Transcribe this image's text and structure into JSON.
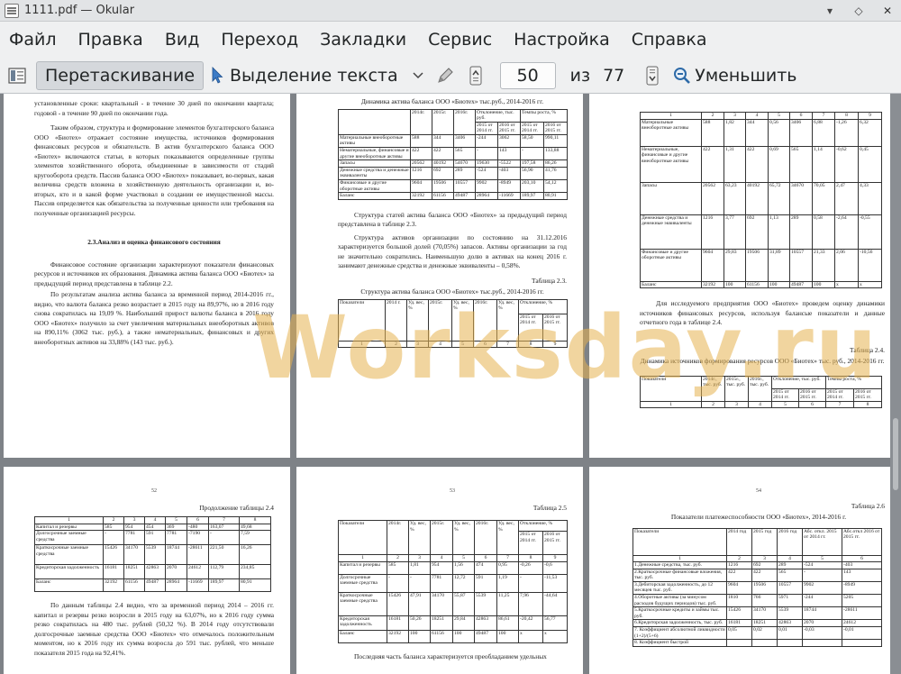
{
  "window": {
    "title": "1111.pdf  — Okular"
  },
  "menu": [
    "Файл",
    "Правка",
    "Вид",
    "Переход",
    "Закладки",
    "Сервис",
    "Настройка",
    "Справка"
  ],
  "toolbar": {
    "drag_label": "Перетаскивание",
    "select_label": "Выделение текста",
    "page_value": "50",
    "of_label": "из",
    "total_pages": "77",
    "zoom_out_label": "Уменьшить"
  },
  "watermark": "Worksday.ru",
  "page1": {
    "p1": "установленные сроки: квартальный - в течение 30 дней по окончании квартала; годовой - в течение 90 дней по окончании года.",
    "p2": "Таким образом, структура и формирование элементов бухгалтерского баланса ООО «Биотех» отражает состояние имущества, источников формирования финансовых ресурсов и обязательств. В актив бухгалтерского баланса ООО «Биотех» включаются статьи, в которых показываются определенные группы элементов хозяйственного оборота, объединенные в зависимости от стадий кругооборота средств. Пассив баланса ООО «Биотех» показывает, во-первых, какая величина средств вложена в хозяйственную деятельность организации и, во-вторых, кто и в какой форме участвовал в создании ее имущественной массы. Пассив определяется как обязательства за полученные ценности или требования на полученные организацией ресурсы.",
    "heading": "2.3.Анализ и оценка финансового состояния",
    "p3": "Финансовое состояние организации характеризуют показатели финансовых ресурсов и источников их образования. Динамика актива баланса ООО «Биотех» за предыдущий период представлена в таблице 2.2.",
    "p4": "По результатам анализа актива баланса за временной период 2014-2016 гг., видно, что валюта баланса резко возрастает в 2015 году на 89,97%, но в 2016 году снова сократилась на 19,09 %. Наибольший прирост валюты баланса в 2016 году ООО «Биотех» получило за счет увеличения материальных внеоборотных активов на 890,11% (3062 тыс. руб.), а также нематериальных, финансовых и других внеоборотных активов на 33,88% (143 тыс. руб.)."
  },
  "page2": {
    "title": "Динамика актива баланса ООО «Биотех» тыс.руб., 2014-2016 гг.",
    "table_header": [
      "",
      "2014г.",
      "2015г.",
      "2016г.",
      "Отклонение, тыс. руб.",
      "Темпы роста, %"
    ],
    "table_subheader": [
      "2015 от 2014 гг.",
      "2016 от 2015 гг.",
      "2015 от 2014 гг.",
      "2016 от 2015 гг."
    ],
    "rows": [
      [
        "Материальные внеоборотные активы",
        "588",
        "344",
        "3406",
        "-244",
        "3062",
        "58,50",
        "990,11"
      ],
      [
        "Нематериальные, финансовые и другие внеоборотные активы",
        "422",
        "422",
        "565",
        "-",
        "143",
        "-",
        "133,88"
      ],
      [
        "Запасы",
        "20562",
        "40192",
        "54670",
        "19630",
        "-5522",
        "197,58",
        "86,26"
      ],
      [
        "Денежные средства и денежные эквиваленты",
        "1216",
        "692",
        "289",
        "-524",
        "-403",
        "56,90",
        "41,76"
      ],
      [
        "Финансовые и другие оборотные активы",
        "9604",
        "19506",
        "10557",
        "9902",
        "-8949",
        "203,10",
        "54,12"
      ],
      [
        "Баланс",
        "32192",
        "61156",
        "49487",
        "28964",
        "-11669",
        "189,97",
        "80,91"
      ]
    ],
    "p1": "Структура статей актива баланса ООО «Биотех» за предыдущий период представлена в таблице 2.3.",
    "p2": "Структура активов организации по состоянию на 31.12.2016 характеризуется большой долей (70,05%) запасов. Активы организации за год не значительно сократились. Наименьшую долю в активах на конец 2016 г. занимают денежные средства и денежные эквиваленты – 0,58%.",
    "table_label": "Таблица 2.3.",
    "t2_title": "Структура актива баланса ООО «Биотех» тыс.руб., 2014-2016 гг.",
    "t2_header": [
      "Показатели",
      "2014 г.",
      "Уд. вес, %",
      "2015г.",
      "Уд. вес, %",
      "2016г.",
      "Уд. вес, %",
      "Отклонение, %"
    ],
    "t2_sub": [
      "2015 от 2014 гг.",
      "2016 от 2015 гг."
    ],
    "t2_nums": [
      "1",
      "2",
      "3",
      "4",
      "5",
      "6",
      "7",
      "8",
      "9"
    ]
  },
  "page3": {
    "t_nums": [
      "1",
      "2",
      "3",
      "4",
      "5",
      "6",
      "7",
      "8",
      "9"
    ],
    "rows": [
      [
        "Материальные внеоборотные активы",
        "588",
        "1,82",
        "344",
        "0,56",
        "3406",
        "6,88",
        "-1,26",
        "6,32"
      ],
      [
        "Нематериальные, финансовые и другие внеоборотные активы",
        "422",
        "1,31",
        "422",
        "0,69",
        "565",
        "1,14",
        "-0,62",
        "0,45"
      ],
      [
        "Запасы",
        "20562",
        "63,23",
        "40192",
        "65,72",
        "34670",
        "70,05",
        "2,47",
        "4,33"
      ],
      [
        "Денежные средства и денежные эквиваленты",
        "1216",
        "3,77",
        "692",
        "1,13",
        "289",
        "0,58",
        "-2,64",
        "-0,55"
      ],
      [
        "Финансовые и другие оборотные активы",
        "9604",
        "29,83",
        "19506",
        "31,89",
        "10557",
        "21,33",
        "2,06",
        "-10,56"
      ],
      [
        "Баланс",
        "32192",
        "100",
        "61156",
        "100",
        "49487",
        "100",
        "х",
        "х"
      ]
    ],
    "p1": "Для исследуемого предприятия ООО «Биотех» проведем оценку динамики источников финансовых ресурсов, используя балансые показатели и данные отчетного года в таблице 2.4.",
    "table_label": "Таблица 2.4.",
    "t_title": "Динамика источников формирования ресурсов ООО «Биотех» тыс. руб., 2014-2016 гг.",
    "t2_header": [
      "Показатели",
      "2014г., тыс. руб.",
      "2015г., тыс. руб.",
      "2016г., тыс. руб.",
      "Отклонение, тыс. руб.",
      "Темпы роста, %"
    ],
    "t2_sub": [
      "2015 от 2014 гг.",
      "2016 от 2015 гг.",
      "2015 от 2014 гг.",
      "2016 от 2015 гг."
    ],
    "t2_nums": [
      "1",
      "2",
      "3",
      "4",
      "5",
      "6",
      "7",
      "8"
    ]
  },
  "page4": {
    "num": "52",
    "label": "Продолжение таблицы 2.4",
    "t_nums": [
      "1",
      "2",
      "3",
      "4",
      "5",
      "6",
      "7",
      "8"
    ],
    "rows": [
      [
        "Капитал и резервы",
        "585",
        "954",
        "454",
        "369",
        "-480",
        "163,07",
        "49,68"
      ],
      [
        "Долгосрочные заемные средства",
        "-",
        "7781",
        "591",
        "7781",
        "-7190",
        "-",
        "7,59"
      ],
      [
        "Краткосрочные заемные средства",
        "15426",
        "34170",
        "5539",
        "18744",
        "-28611",
        "221,50",
        "16,26"
      ],
      [
        "Кредиторская задолженность",
        "16181",
        "18251",
        "42863",
        "2070",
        "24612",
        "112,79",
        "234,85"
      ],
      [
        "Баланс",
        "32192",
        "61156",
        "49487",
        "28964",
        "-11669",
        "189,97",
        "80,91"
      ]
    ],
    "p1": "По данным таблицы 2.4 видно, что за временной период 2014 – 2016 гг. капитал и резервы резко возросли в 2015 году на 63,07%, но к 2016 году сумма резко сократилась на 480 тыс. рублей (50,32 %). В 2014 году отсутствовали долгосрочные заемные средства ООО «Биотех» что отмечалось положительным моментом, но к 2016 году их сумма возросла до 591 тыс. рублей, что меньше показателя 2015 года на 92,41%."
  },
  "page5": {
    "num": "53",
    "label": "Таблица 2.5",
    "t_header": [
      "Показатели",
      "2014г.",
      "Уд. вес, %",
      "2015г.",
      "Уд. вес, %",
      "2016г.",
      "Уд. вес, %",
      "Отклонение, %"
    ],
    "t_sub": [
      "2015 от 2014 гг.",
      "2016 от 2015 гг."
    ],
    "t_nums": [
      "1",
      "2",
      "3",
      "4",
      "5",
      "6",
      "7",
      "8",
      "9"
    ],
    "rows": [
      [
        "Капитал и резервы",
        "585",
        "1,81",
        "954",
        "1,56",
        "474",
        "0,95",
        "-0,26",
        "-0,6"
      ],
      [
        "Долгосрочные заемные средства",
        "-",
        "-",
        "7781",
        "12,72",
        "591",
        "1,19",
        "-",
        "-11,53"
      ],
      [
        "Краткосрочные заемные средства",
        "15426",
        "47,91",
        "34170",
        "55,87",
        "5539",
        "11,25",
        "7,96",
        "-44,64"
      ],
      [
        "Кредиторская задолженность",
        "16181",
        "50,26",
        "18251",
        "29,84",
        "42863",
        "86,61",
        "-20,42",
        "56,77"
      ],
      [
        "Баланс",
        "32192",
        "100",
        "61156",
        "100",
        "49487",
        "100",
        "х",
        "х"
      ]
    ],
    "p1": "Последняя часть баланса характеризуется преобладанием удельных"
  },
  "page6": {
    "num": "54",
    "label": "Таблица 2.6",
    "t_title": "Показатели платежеспособности ООО «Биотех», 2014-2016 г.",
    "t_header": [
      "Показатели",
      "2014 год",
      "2015 год",
      "2016 год",
      "Абс. откл. 2015 от 2014 гг.",
      "Абс.откл 2016 от 2015 гг."
    ],
    "t_nums": [
      "1",
      "2",
      "3",
      "4",
      "5",
      "6"
    ],
    "rows": [
      [
        "1.Денежные средства, тыс. руб.",
        "1216",
        "692",
        "289",
        "-524",
        "-403"
      ],
      [
        "2.Краткосрочные финансовые вложения, тыс. руб.",
        "422",
        "422",
        "565",
        "-",
        "143"
      ],
      [
        "3.Дебиторская задолженность, до 12 месяцев тыс. руб.",
        "9604",
        "19506",
        "10557",
        "9902",
        "-8949"
      ],
      [
        "4.Оборотные активы (за минусом расходов будущих периодов) тыс. руб.",
        "1810",
        "766",
        "5971",
        "-244",
        "5205"
      ],
      [
        "5.Краткосрочные кредиты и займы тыс. руб.",
        "15426",
        "34170",
        "5539",
        "18744",
        "-28611"
      ],
      [
        "6.Кредиторская задолженность, тыс. руб.",
        "16181",
        "18251",
        "42863",
        "2070",
        "24612"
      ],
      [
        "7. Коэффициент абсолютной ликвидности (1+2)/(5+6)",
        "0,05",
        "0,02",
        "0,01",
        "-0,03",
        "-0,01"
      ],
      [
        "8. Коэффициент быстрой",
        "",
        "",
        "",
        "",
        ""
      ]
    ]
  }
}
